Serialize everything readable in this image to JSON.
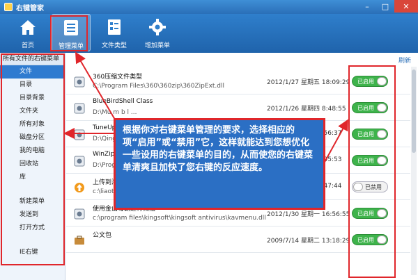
{
  "window": {
    "title": "右键管家"
  },
  "toolbar": {
    "buttons": [
      {
        "label": "首页",
        "icon": "home-icon"
      },
      {
        "label": "管理菜单",
        "icon": "menu-manage-icon",
        "active": true
      },
      {
        "label": "文件类型",
        "icon": "file-type-icon"
      },
      {
        "label": "增加菜单",
        "icon": "gear-icon"
      }
    ]
  },
  "sidebar": {
    "header": "所有文件的右键菜单",
    "group1": [
      "文件",
      "目录",
      "目录背景",
      "文件夹",
      "所有对象",
      "磁盘分区",
      "我的电脑",
      "回收站",
      "库"
    ],
    "group2": [
      "新建菜单",
      "发送到",
      "打开方式"
    ],
    "group3": [
      "IE右键"
    ]
  },
  "main": {
    "refresh_label": "刷新",
    "rows": [
      {
        "name": "360压缩文件类型",
        "path": "C:\\Program Files\\360\\360zip\\360ZipExt.dll",
        "date": "2012/1/27 星期五 18:09:29",
        "status": "已启用",
        "on": true
      },
      {
        "name": "BlueBirdShell Class",
        "path": "D:\\Mu m    b    l  ...",
        "date": "2012/1/26 星期四 8:48:55",
        "status": "已启用",
        "on": true
      },
      {
        "name": "TuneUp",
        "path": "D:\\Qing",
        "date": "20:56:37",
        "status": "已启用",
        "on": true
      },
      {
        "name": "WinZip",
        "path": "D:\\Prog",
        "date": "17:05:53",
        "status": "已启用",
        "on": true
      },
      {
        "name": "上传到淘",
        "path": "c:\\liaotian...",
        "date": "19:47:44",
        "status": "已禁用",
        "on": false
      },
      {
        "name": "使用金山毒霸进行扫描",
        "path": "c:\\program files\\kingsoft\\kingsoft antivirus\\kavmenu.dll",
        "date": "2012/1/30 星期一 16:56:55",
        "status": "已启用",
        "on": true
      },
      {
        "name": "公文包",
        "path": "",
        "date": "2009/7/14 星期二 13:18:29",
        "status": "已启用",
        "on": true
      }
    ]
  },
  "callout": {
    "text": "根据你对右键菜单管理的要求，选择相应的项“启用”或“禁用”它，这样就能达到您想优化一些设用的右键菜单的目的，从而使您的右键菜单清爽且加快了您右键的反应速度。"
  },
  "colors": {
    "accent": "#2a6fb8",
    "highlight_box": "#e0262b",
    "enabled": "#3eb34b"
  }
}
